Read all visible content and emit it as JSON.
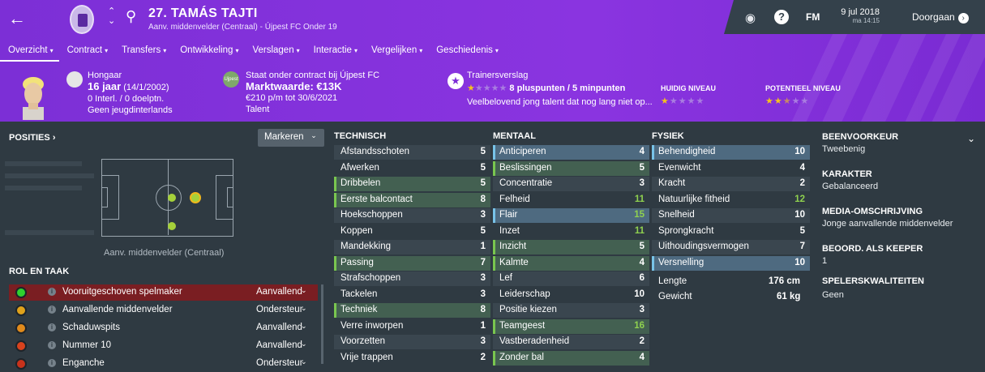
{
  "header": {
    "player_name": "27. TAMÁS TAJTI",
    "subtitle": "Aanv. middenvelder (Centraal) - Újpest FC Onder 19",
    "date": "9 jul 2018",
    "time": "ma 14:15",
    "fm_label": "FM",
    "continue_label": "Doorgaan"
  },
  "nav": [
    "Overzicht",
    "Contract",
    "Transfers",
    "Ontwikkeling",
    "Verslagen",
    "Interactie",
    "Vergelijken",
    "Geschiedenis"
  ],
  "info": {
    "nationality": "Hongaar",
    "age": "16 jaar",
    "birth": "(14/1/2002)",
    "caps": "0 Interl. / 0 doelptn.",
    "youth": "Geen jeugdinterlands",
    "contract_status": "Staat onder contract bij Újpest FC",
    "market_value": "Marktwaarde: €13K",
    "wage": "€210 p/m tot 30/6/2021",
    "type": "Talent",
    "club_badge_text": "Ujpest",
    "trainer_label": "Trainersverslag",
    "points": "8 pluspunten / 5 minpunten",
    "trainer_comment": "Veelbelovend jong talent dat nog lang niet op...",
    "current_level_label": "HUIDIG NIVEAU",
    "potential_level_label": "POTENTIEEL NIVEAU",
    "current_stars": 1,
    "potential_stars": 2.5,
    "report_stars": 1
  },
  "positions": {
    "header": "POSITIES",
    "mark_button": "Markeren",
    "caption": "Aanv. middenvelder (Centraal)"
  },
  "roles": {
    "header": "ROL EN TAAK",
    "items": [
      {
        "name": "Vooruitgeschoven spelmaker",
        "duty": "Aanvallend",
        "color": "#2fd12f",
        "selected": true
      },
      {
        "name": "Aanvallende middenvelder",
        "duty": "Ondersteunend",
        "color": "#e0a21b",
        "selected": false
      },
      {
        "name": "Schaduwspits",
        "duty": "Aanvallend",
        "color": "#e08a1b",
        "selected": false
      },
      {
        "name": "Nummer 10",
        "duty": "Aanvallend",
        "color": "#d8421d",
        "selected": false
      },
      {
        "name": "Enganche",
        "duty": "Ondersteunend",
        "color": "#c8321b",
        "selected": false
      }
    ],
    "info_glyph": "i"
  },
  "technical": {
    "header": "TECHNISCH",
    "rows": [
      {
        "name": "Afstandsschoten",
        "value": "5",
        "hl": ""
      },
      {
        "name": "Afwerken",
        "value": "5",
        "hl": ""
      },
      {
        "name": "Dribbelen",
        "value": "5",
        "hl": "green"
      },
      {
        "name": "Eerste balcontact",
        "value": "8",
        "hl": "green"
      },
      {
        "name": "Hoekschoppen",
        "value": "3",
        "hl": ""
      },
      {
        "name": "Koppen",
        "value": "5",
        "hl": ""
      },
      {
        "name": "Mandekking",
        "value": "1",
        "hl": ""
      },
      {
        "name": "Passing",
        "value": "7",
        "hl": "green"
      },
      {
        "name": "Strafschoppen",
        "value": "3",
        "hl": ""
      },
      {
        "name": "Tackelen",
        "value": "3",
        "hl": ""
      },
      {
        "name": "Techniek",
        "value": "8",
        "hl": "green"
      },
      {
        "name": "Verre inworpen",
        "value": "1",
        "hl": ""
      },
      {
        "name": "Voorzetten",
        "value": "3",
        "hl": ""
      },
      {
        "name": "Vrije trappen",
        "value": "2",
        "hl": ""
      }
    ]
  },
  "mental": {
    "header": "MENTAAL",
    "rows": [
      {
        "name": "Anticiperen",
        "value": "4",
        "hl": "blue"
      },
      {
        "name": "Beslissingen",
        "value": "5",
        "hl": "green"
      },
      {
        "name": "Concentratie",
        "value": "3",
        "hl": ""
      },
      {
        "name": "Felheid",
        "value": "11",
        "hl": ""
      },
      {
        "name": "Flair",
        "value": "15",
        "hl": "blue"
      },
      {
        "name": "Inzet",
        "value": "11",
        "hl": ""
      },
      {
        "name": "Inzicht",
        "value": "5",
        "hl": "green"
      },
      {
        "name": "Kalmte",
        "value": "4",
        "hl": "green"
      },
      {
        "name": "Lef",
        "value": "6",
        "hl": ""
      },
      {
        "name": "Leiderschap",
        "value": "10",
        "hl": ""
      },
      {
        "name": "Positie kiezen",
        "value": "3",
        "hl": ""
      },
      {
        "name": "Teamgeest",
        "value": "16",
        "hl": "green"
      },
      {
        "name": "Vastberadenheid",
        "value": "2",
        "hl": ""
      },
      {
        "name": "Zonder bal",
        "value": "4",
        "hl": "green"
      }
    ]
  },
  "physical": {
    "header": "FYSIEK",
    "rows": [
      {
        "name": "Behendigheid",
        "value": "10",
        "hl": "blue"
      },
      {
        "name": "Evenwicht",
        "value": "4",
        "hl": ""
      },
      {
        "name": "Kracht",
        "value": "2",
        "hl": ""
      },
      {
        "name": "Natuurlijke fitheid",
        "value": "12",
        "hl": ""
      },
      {
        "name": "Snelheid",
        "value": "10",
        "hl": ""
      },
      {
        "name": "Sprongkracht",
        "value": "5",
        "hl": ""
      },
      {
        "name": "Uithoudingsvermogen",
        "value": "7",
        "hl": ""
      },
      {
        "name": "Versnelling",
        "value": "10",
        "hl": "blue"
      }
    ],
    "height_label": "Lengte",
    "height_value": "176 cm",
    "weight_label": "Gewicht",
    "weight_value": "61 kg"
  },
  "right": {
    "foot_label": "BEENVOORKEUR",
    "foot_value": "Tweebenig",
    "character_label": "KARAKTER",
    "character_value": "Gebalanceerd",
    "media_label": "MEDIA-OMSCHRIJVING",
    "media_value": "Jonge aanvallende middenvelder",
    "keeper_label": "BEOORD. ALS KEEPER",
    "keeper_value": "1",
    "quality_label": "SPELERSKWALITEITEN",
    "quality_value": "Geen"
  },
  "colors": {
    "header_purple": "#8a34e0",
    "attr_green": "#79c64f",
    "attr_blue": "#78c3e8",
    "selected_role": "#7a1e22"
  }
}
